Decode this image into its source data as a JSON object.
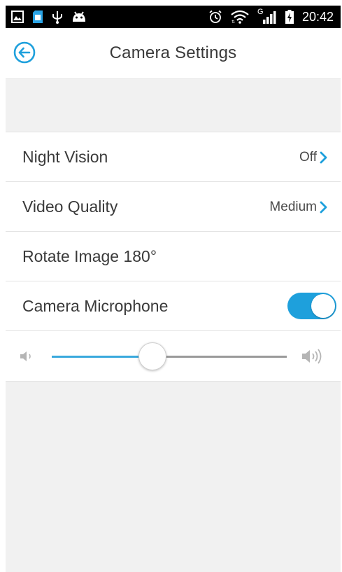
{
  "status_bar": {
    "time": "20:42",
    "network_label": "G",
    "icons_left": [
      "image-icon",
      "sd-card-icon",
      "usb-icon",
      "android-icon"
    ],
    "icons_right": [
      "alarm-icon",
      "wifi-icon",
      "signal-icon",
      "battery-icon"
    ]
  },
  "header": {
    "title": "Camera Settings",
    "back_icon": "back-arrow-circle-icon"
  },
  "settings": {
    "night_vision": {
      "label": "Night Vision",
      "value": "Off"
    },
    "video_quality": {
      "label": "Video Quality",
      "value": "Medium"
    },
    "rotate_image": {
      "label": "Rotate Image 180°"
    },
    "camera_microphone": {
      "label": "Camera Microphone",
      "enabled": true
    }
  },
  "volume": {
    "level_percent": 43,
    "low_icon": "volume-low-icon",
    "high_icon": "volume-high-icon"
  },
  "colors": {
    "accent": "#1ea0dc",
    "status_bar": "#000000",
    "background": "#f1f1f1"
  }
}
